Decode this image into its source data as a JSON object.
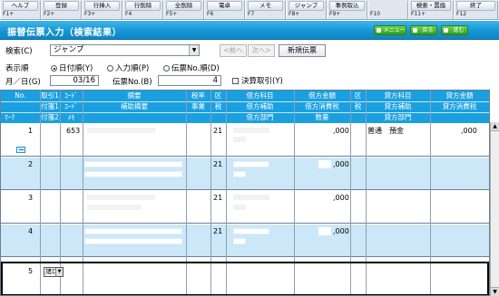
{
  "fkeys": [
    {
      "label": "ヘルプ",
      "key": "F1+"
    },
    {
      "label": "登録",
      "key": "F2+"
    },
    {
      "label": "行挿入",
      "key": "F3+"
    },
    {
      "label": "行削除",
      "key": "F4"
    },
    {
      "label": "全削除",
      "key": "F5+"
    },
    {
      "label": "電卓",
      "key": "F6"
    },
    {
      "label": "メモ",
      "key": "F7"
    },
    {
      "label": "ジャンプ",
      "key": "F8+"
    },
    {
      "label": "事例取込",
      "key": "F9+"
    },
    {
      "label": "",
      "key": "F10"
    },
    {
      "label": "検索・置換",
      "key": "F11+"
    },
    {
      "label": "終了",
      "key": "F12"
    }
  ],
  "titlebar": {
    "title": "振替伝票入力（検索結果）",
    "menu": "メニュー",
    "back": "戻る",
    "next": "進む"
  },
  "form": {
    "search_label": "検索(C)",
    "search_value": "ジャンプ",
    "prev": "<前へ",
    "next": "次へ>",
    "new_slip": "新規伝票",
    "order_label": "表示順",
    "order_opt1": "日付順(Y)",
    "order_opt2": "入力順(P)",
    "order_opt3": "伝票No.順(D)",
    "date_label": "月／日(G)",
    "date_value": "03/16",
    "slip_label": "伝票No.(B)",
    "slip_value": "4",
    "settle_label": "決算取引(Y)"
  },
  "grid": {
    "head_r1": {
      "no": "No.",
      "torihiki1": "取引1",
      "code": "ｺｰﾄﾞ",
      "tekiyo": "摘要",
      "zeiritsu": "税率",
      "ku1": "区",
      "kari_kamoku": "借方科目",
      "kari_kingaku": "借方金額",
      "ku2": "区",
      "kashi_kamoku": "貸方科目",
      "kashi_kingaku": "貸方金額"
    },
    "head_r2": {
      "fusen1": "付箋1",
      "code2": "ｺｰﾄﾞ",
      "hojo_tekiyo": "補助摘要",
      "jigyo": "事業",
      "zei1": "税",
      "kari_hojo": "借方補助",
      "kari_shohizei": "借方消費税",
      "zei2": "税",
      "kashi_hojo": "貸方補助",
      "kashi_shohizei": "貸方消費税"
    },
    "head_r3": {
      "mark": "ﾏｰｸ",
      "fusen2": "付箋2",
      "memo": "ﾒﾓ",
      "kari_bumon": "借方部門",
      "suryo": "数量",
      "kashi_bumon": "貸方部門"
    },
    "rows": [
      {
        "no": "1",
        "code": "653",
        "zei": "21",
        "kari_amount": ",000",
        "kashi_kamoku": "普通　預金",
        "kashi_amount": ",000"
      },
      {
        "no": "2",
        "code": "",
        "zei": "21",
        "kari_amount": ",000",
        "kashi_kamoku": "",
        "kashi_amount": ""
      },
      {
        "no": "3",
        "code": "",
        "zei": "21",
        "kari_amount": ",000",
        "kashi_kamoku": "",
        "kashi_amount": ""
      },
      {
        "no": "4",
        "code": "",
        "zei": "21",
        "kari_amount": ",000",
        "kashi_kamoku": "",
        "kashi_amount": ""
      },
      {
        "no": "5",
        "code": "",
        "zei": "",
        "kari_amount": "",
        "kashi_kamoku": "",
        "kashi_amount": ""
      }
    ],
    "row5_select": "諸口"
  }
}
